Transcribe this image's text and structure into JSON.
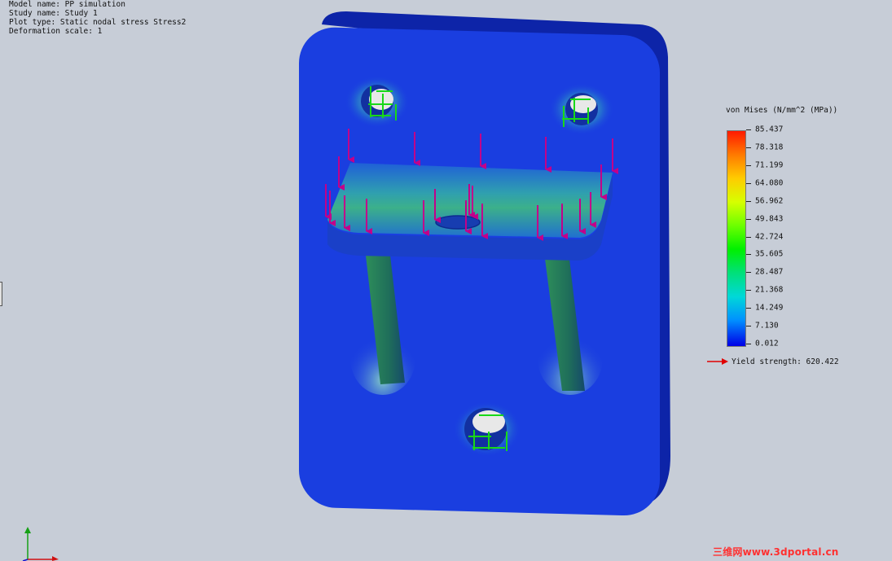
{
  "header": {
    "model_name": "Model name: PP simulation",
    "study_name": "Study name: Study 1",
    "plot_type": "Plot type: Static nodal stress Stress2",
    "deformation_scale": "Deformation scale: 1"
  },
  "legend": {
    "title": "von Mises (N/mm^2 (MPa))",
    "values": [
      "85.437",
      "78.318",
      "71.199",
      "64.080",
      "56.962",
      "49.843",
      "42.724",
      "35.605",
      "28.487",
      "21.368",
      "14.249",
      "7.130",
      "0.012"
    ],
    "max_value": 85.437,
    "min_value": 0.012,
    "yield_label": "Yield strength: 620.422",
    "colors": {
      "max": "#ff1a00",
      "mid": "#00f000",
      "min": "#0000e6"
    }
  },
  "model": {
    "plate_color": "#1a3ee0",
    "plate_edge_color": "#0d24a8",
    "load_arrow_color": "#c2008a",
    "fixture_color": "#18d818"
  },
  "watermark": "三维网www.3dportal.cn",
  "icons": {
    "load_arrow": "down-arrow-icon",
    "fixture": "fixture-arrow-icon",
    "triad": "axis-triad-icon",
    "yield_marker": "right-arrow-icon"
  }
}
